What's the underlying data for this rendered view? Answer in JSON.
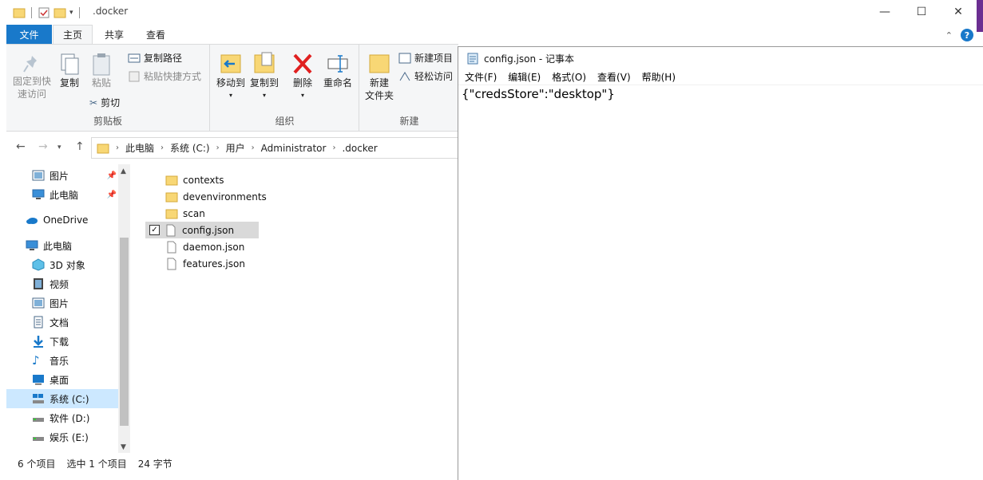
{
  "explorer": {
    "title": ".docker",
    "menu_tabs": [
      {
        "label": "文件"
      },
      {
        "label": "主页"
      },
      {
        "label": "共享"
      },
      {
        "label": "查看"
      }
    ],
    "ribbon": {
      "clipboard": {
        "label": "剪贴板",
        "pin_quick": "固定到快\n速访问",
        "copy": "复制",
        "paste": "粘贴",
        "copy_path": "复制路径",
        "paste_shortcut": "粘贴快捷方式",
        "cut": "剪切"
      },
      "organize": {
        "label": "组织",
        "move_to": "移动到",
        "copy_to": "复制到",
        "delete": "删除",
        "rename": "重命名"
      },
      "new": {
        "label": "新建",
        "new_folder": "新建\n文件夹",
        "new_item": "新建项目",
        "easy_access": "轻松访问"
      }
    },
    "breadcrumb": [
      "此电脑",
      "系统 (C:)",
      "用户",
      "Administrator",
      ".docker"
    ],
    "nav_items": [
      {
        "label": "图片",
        "icon": "pictures-icon",
        "pinned": true
      },
      {
        "label": "此电脑",
        "icon": "computer-icon",
        "pinned": true
      },
      {
        "label": "OneDrive",
        "icon": "onedrive-icon"
      },
      {
        "label": "此电脑",
        "icon": "computer-icon"
      },
      {
        "label": "3D 对象",
        "icon": "3d-objects-icon"
      },
      {
        "label": "视频",
        "icon": "videos-icon"
      },
      {
        "label": "图片",
        "icon": "pictures-icon"
      },
      {
        "label": "文档",
        "icon": "documents-icon"
      },
      {
        "label": "下载",
        "icon": "downloads-icon"
      },
      {
        "label": "音乐",
        "icon": "music-icon"
      },
      {
        "label": "桌面",
        "icon": "desktop-icon"
      },
      {
        "label": "系统 (C:)",
        "icon": "drive-c-icon",
        "selected": true
      },
      {
        "label": "软件 (D:)",
        "icon": "drive-icon"
      },
      {
        "label": "娱乐 (E:)",
        "icon": "drive-icon"
      }
    ],
    "files": [
      {
        "name": "contexts",
        "type": "folder"
      },
      {
        "name": "devenvironments",
        "type": "folder"
      },
      {
        "name": "scan",
        "type": "folder"
      },
      {
        "name": "config.json",
        "type": "file",
        "selected": true
      },
      {
        "name": "daemon.json",
        "type": "file"
      },
      {
        "name": "features.json",
        "type": "file"
      }
    ],
    "status": {
      "count": "6 个项目",
      "selected": "选中 1 个项目",
      "size": "24 字节"
    }
  },
  "notepad": {
    "title": "config.json - 记事本",
    "menu": [
      "文件(F)",
      "编辑(E)",
      "格式(O)",
      "查看(V)",
      "帮助(H)"
    ],
    "content": "{\"credsStore\":\"desktop\"}"
  },
  "colors": {
    "accent": "#1979ca",
    "folder": "#f8d775",
    "selection": "#cce8ff"
  }
}
